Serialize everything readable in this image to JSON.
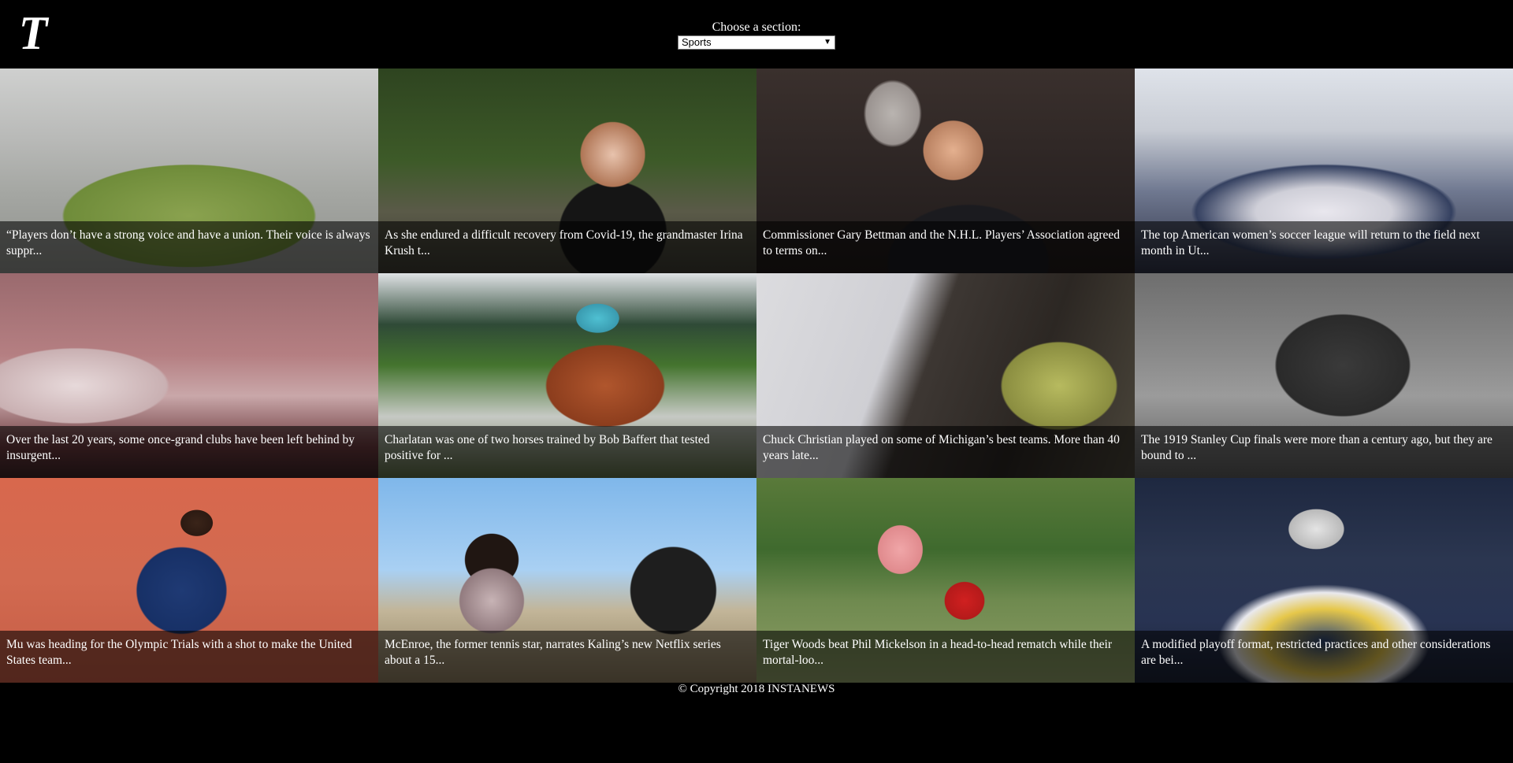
{
  "header": {
    "logo_alt": "T",
    "section_label": "Choose a section:",
    "section_selected": "Sports"
  },
  "articles": [
    {
      "abstract": "“Players don’t have a strong voice and have a union. Their voice is always suppr..."
    },
    {
      "abstract": "As she endured a difficult recovery from Covid-19, the grandmaster Irina Krush t..."
    },
    {
      "abstract": "Commissioner Gary Bettman and the N.H.L. Players’ Association agreed to terms on..."
    },
    {
      "abstract": "The top American women’s soccer league will return to the field next month in Ut..."
    },
    {
      "abstract": "Over the last 20 years, some once-grand clubs have been left behind by insurgent..."
    },
    {
      "abstract": "Charlatan was one of two horses trained by Bob Baffert that tested positive for ..."
    },
    {
      "abstract": "Chuck Christian played on some of Michigan’s best teams. More than 40 years late..."
    },
    {
      "abstract": "The 1919 Stanley Cup finals were more than a century ago, but they are bound to ..."
    },
    {
      "abstract": "Mu was heading for the Olympic Trials with a shot to make the United States team..."
    },
    {
      "abstract": "McEnroe, the former tennis star, narrates Kaling’s new Netflix series about a 15..."
    },
    {
      "abstract": "Tiger Woods beat Phil Mickelson in a head-to-head rematch while their mortal-loo..."
    },
    {
      "abstract": "A modified playoff format, restricted practices and other considerations are bei..."
    }
  ],
  "footer": {
    "copyright": "© Copyright 2018 INSTANEWS"
  }
}
